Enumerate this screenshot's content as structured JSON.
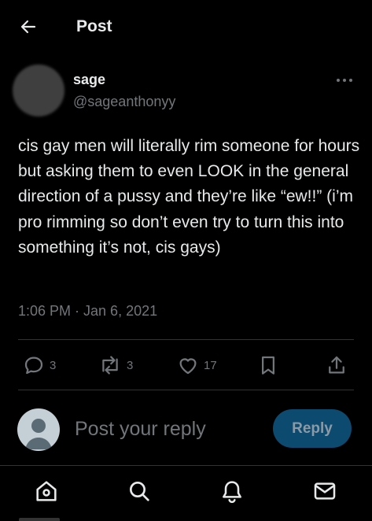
{
  "header": {
    "title": "Post",
    "back_icon": "arrow-left-icon"
  },
  "post": {
    "author_name": "sage",
    "author_handle": "@sageanthonyy",
    "text": "cis gay men will literally rim someone for hours but asking them to even LOOK in the general direction of a pussy and they’re like “ew!!” (i’m pro rimming so don’t even try to turn this into something it’s not, cis gays)",
    "timestamp": "1:06 PM · Jan 6, 2021",
    "more_icon": "more-horizontal-icon"
  },
  "actions": {
    "replies": "3",
    "reposts": "3",
    "likes": "17",
    "icons": [
      "reply-icon",
      "repost-icon",
      "like-icon",
      "bookmark-icon",
      "share-icon"
    ]
  },
  "reply_box": {
    "placeholder": "Post your reply",
    "button_label": "Reply",
    "button_color": "#0c4a70"
  },
  "bottom_nav": {
    "icons": [
      "home-icon",
      "search-icon",
      "notifications-icon",
      "messages-icon"
    ]
  },
  "colors": {
    "background": "#000000",
    "text": "#e7e9ea",
    "secondary": "#71767b",
    "divider": "#2f3336"
  }
}
